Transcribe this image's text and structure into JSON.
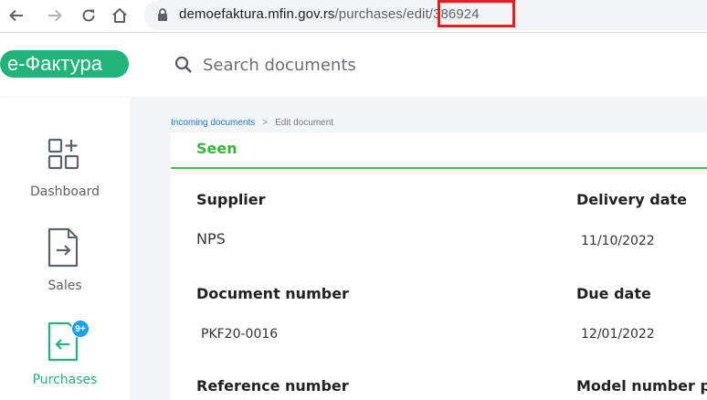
{
  "browser": {
    "url_host": "demoefaktura.mfin.gov.rs",
    "url_path": "/purchases/edit/386924",
    "icons": [
      "back-arrow-icon",
      "forward-arrow-icon",
      "reload-icon",
      "home-icon",
      "lock-icon"
    ]
  },
  "header": {
    "logo": "е-Фактура",
    "search_placeholder": "Search documents"
  },
  "sidebar": {
    "items": [
      {
        "label": "Dashboard",
        "icon": "dashboard-icon"
      },
      {
        "label": "Sales",
        "icon": "sales-document-icon"
      },
      {
        "label": "Purchases",
        "icon": "purchases-document-icon",
        "badge": "9+",
        "active": true
      }
    ]
  },
  "breadcrumb": {
    "parent": "Incoming documents",
    "separator": ">",
    "current": "Edit document"
  },
  "document": {
    "status": "Seen",
    "fields": {
      "supplier": {
        "label": "Supplier",
        "value": "NPS"
      },
      "delivery_date": {
        "label": "Delivery date",
        "value": "11/10/2022"
      },
      "document_number": {
        "label": "Document number",
        "value": "PKF20-0016"
      },
      "due_date": {
        "label": "Due date",
        "value": "12/01/2022"
      },
      "reference_number": {
        "label": "Reference number"
      },
      "model_number": {
        "label": "Model number p"
      }
    }
  },
  "colors": {
    "brand_green": "#21b37a",
    "status_green": "#3cb13c",
    "badge_blue": "#1fa1e8",
    "highlight_red": "#e0201c",
    "link_blue": "#1976d2"
  }
}
